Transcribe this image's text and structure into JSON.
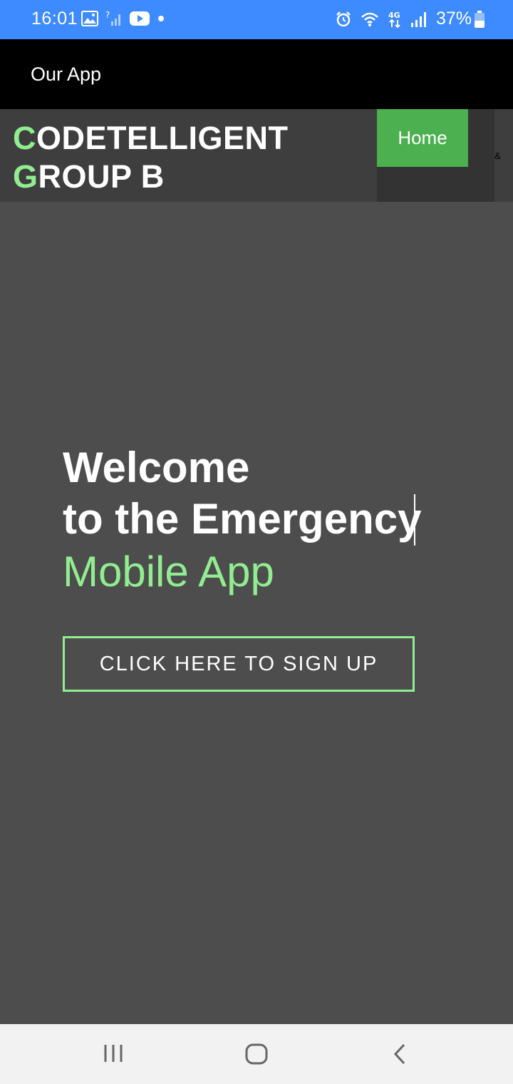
{
  "status_bar": {
    "time": "16:01",
    "battery": "37%",
    "left_icons": [
      "gallery-icon",
      "no-signal-icon",
      "youtube-icon",
      "dot-icon"
    ],
    "right_icons": [
      "alarm-icon",
      "wifi-icon",
      "4g-icon",
      "signal-icon",
      "battery-icon"
    ]
  },
  "app_bar": {
    "title": "Our App"
  },
  "header": {
    "logo_line1_first": "C",
    "logo_line1_rest": "ODETELLIGENT",
    "logo_line2_first": "G",
    "logo_line2_rest": "ROUP B",
    "nav_home": "Home",
    "nav_extra": "&"
  },
  "hero": {
    "line1": "Welcome",
    "line2": "to the Emergency",
    "line3": "Mobile App",
    "cta": "CLICK HERE TO SIGN UP"
  },
  "nav_bar": {
    "icons": [
      "recent-apps-icon",
      "home-icon",
      "back-icon"
    ]
  },
  "colors": {
    "status_bar": "#3d8bff",
    "accent_green": "#90ee90",
    "home_button": "#4caf50",
    "background": "#4d4d4d"
  }
}
